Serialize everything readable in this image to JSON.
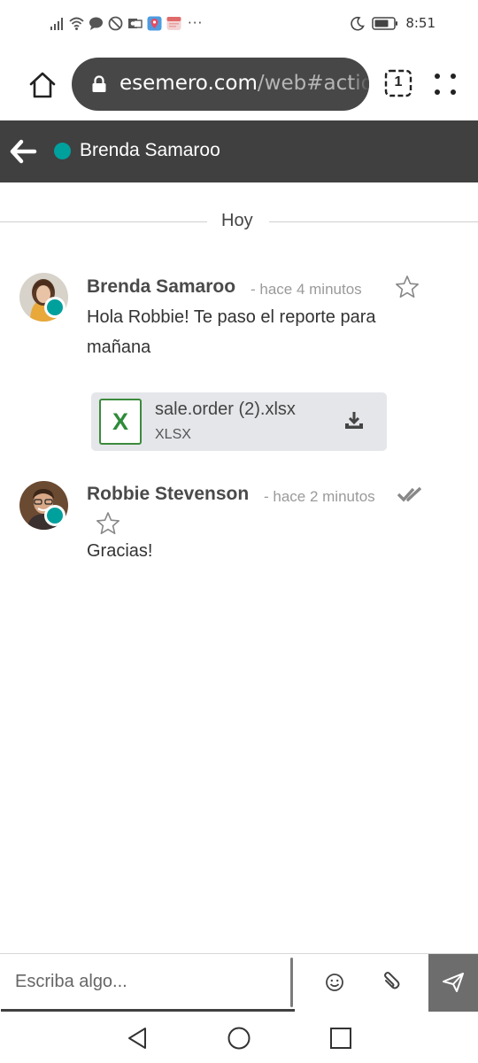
{
  "status_bar": {
    "time": "8:51",
    "overflow": "···",
    "icons_left": [
      "signal-icon",
      "wifi-icon",
      "chat-bubble-icon",
      "do-not-disturb-icon",
      "outlook-icon",
      "location-app-icon",
      "calendar-app-icon"
    ],
    "icons_right": [
      "moon-icon",
      "battery-icon"
    ]
  },
  "browser": {
    "url_host": "esemero.com",
    "url_path": "/web#action",
    "tab_count": "1"
  },
  "header": {
    "title": "Brenda Samaroo",
    "status_color": "#00a09d"
  },
  "date_separator": "Hoy",
  "messages": [
    {
      "author": "Brenda Samaroo",
      "time": "- hace 4 minutos",
      "body_line1": "Hola Robbie! Te paso el reporte para",
      "body_line2": "mañana",
      "attachment": {
        "name": "sale.order (2).xlsx",
        "ext": "XLSX",
        "icon_letter": "X"
      }
    },
    {
      "author": "Robbie Stevenson",
      "time": "- hace 2 minutos",
      "body": "Gracias!"
    }
  ],
  "composer": {
    "placeholder": "Escriba algo..."
  },
  "colors": {
    "header_bg": "#404040",
    "accent_teal": "#00a09d",
    "send_bg": "#6d6d6d",
    "excel_green": "#2e8b3a"
  }
}
